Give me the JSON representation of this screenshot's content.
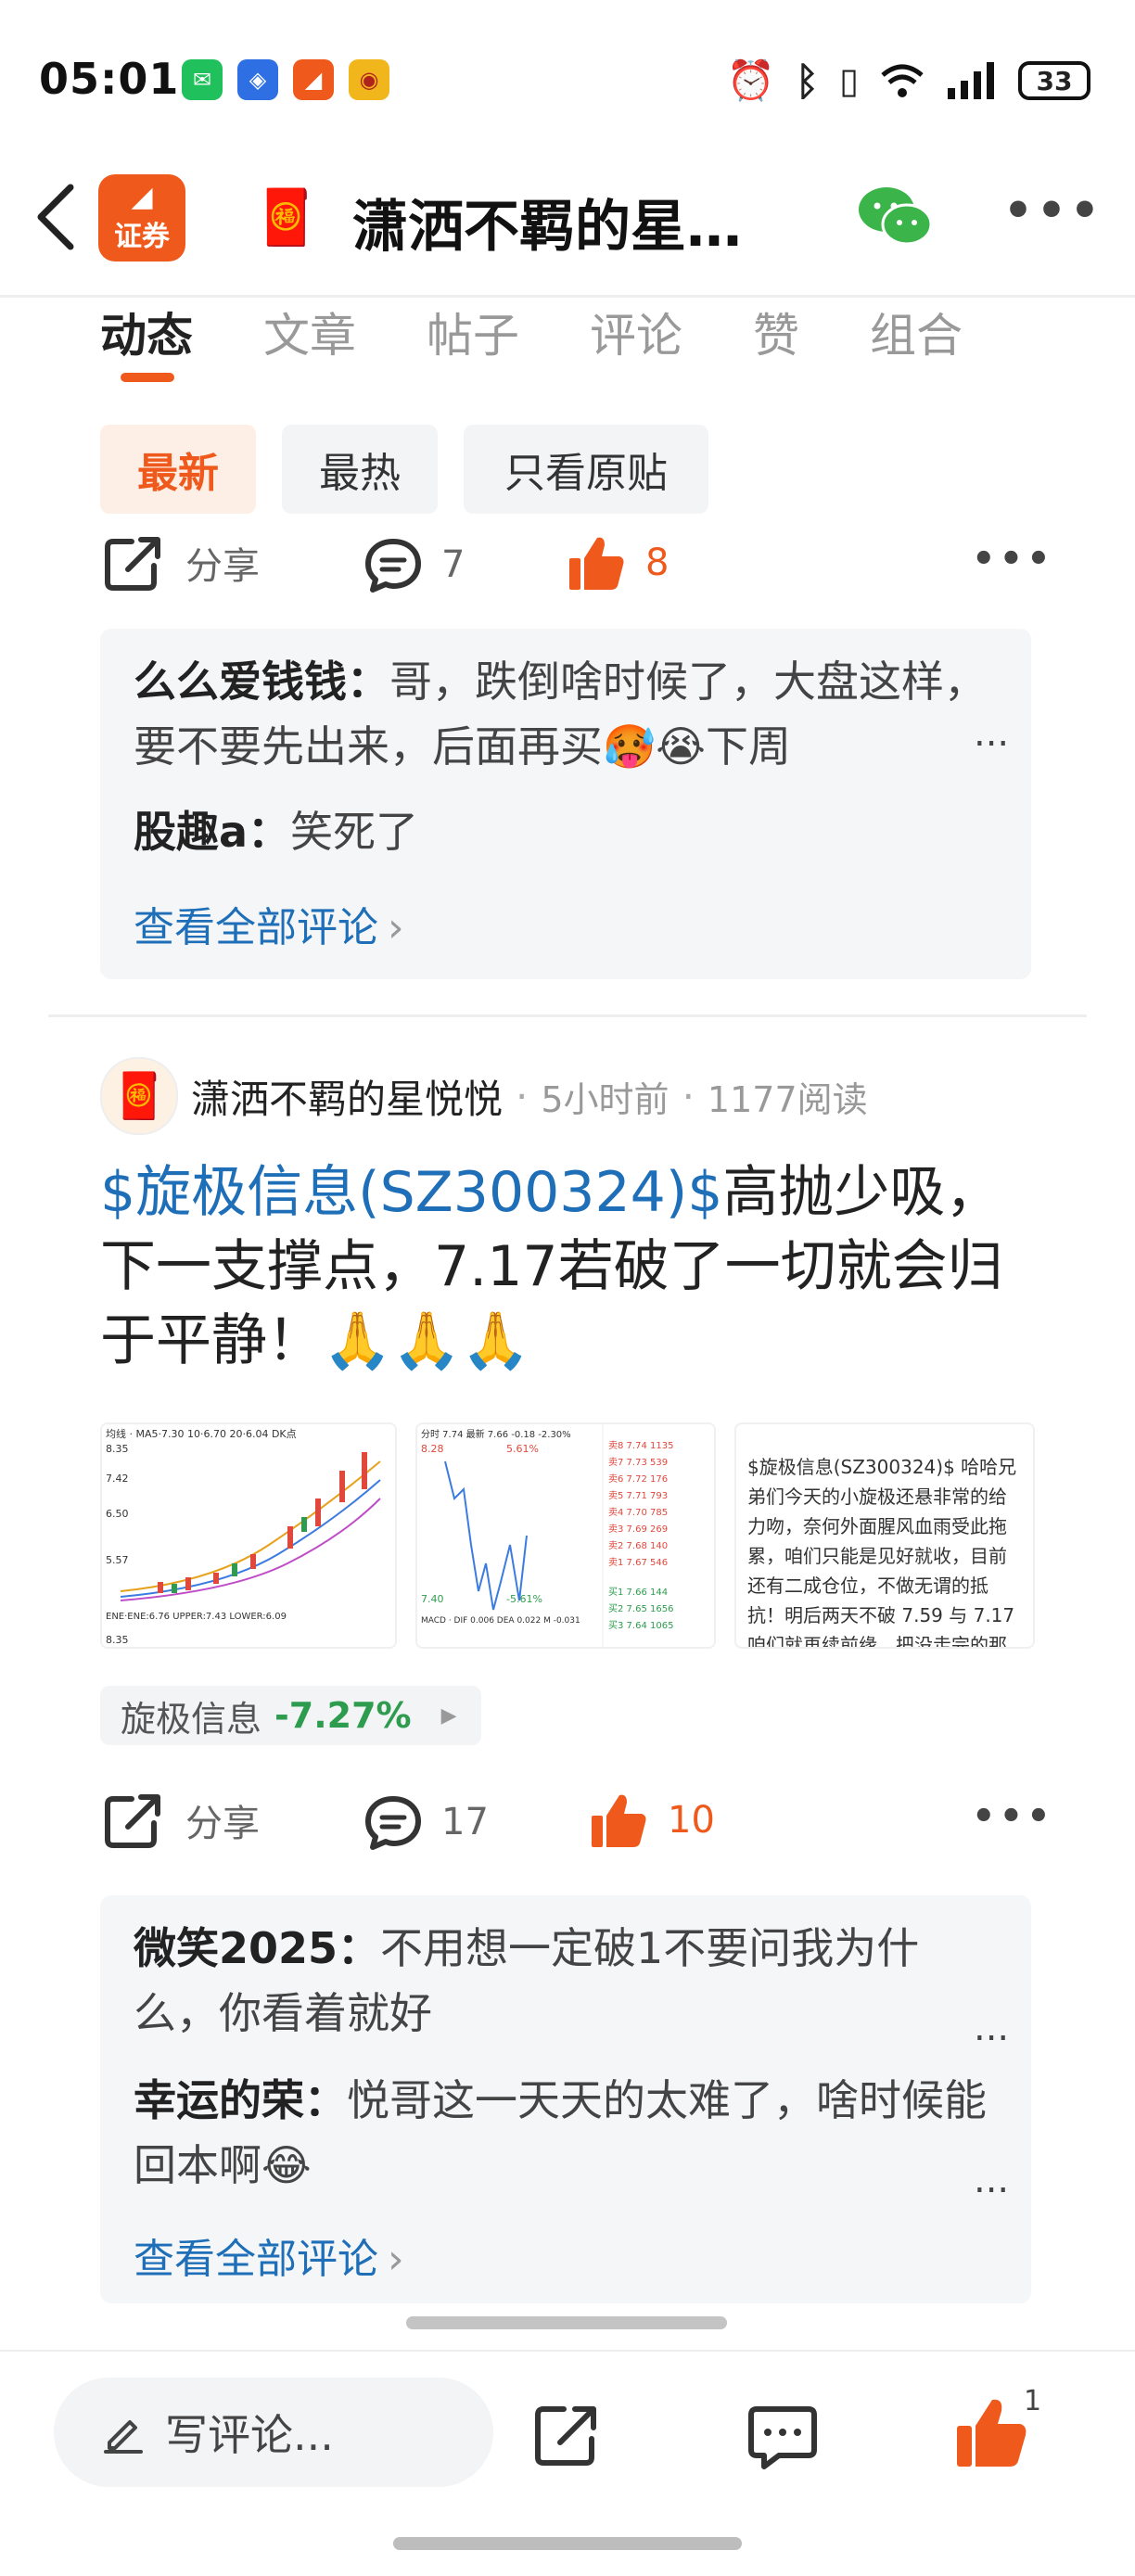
{
  "status": {
    "time": "05:01",
    "battery": "33"
  },
  "header": {
    "brand_label": "证券",
    "title": "潇洒不羁的星…"
  },
  "tabs": [
    "动态",
    "文章",
    "帖子",
    "评论",
    "赞",
    "组合"
  ],
  "filters": [
    "最新",
    "最热",
    "只看原贴"
  ],
  "post1": {
    "share": "分享",
    "comments": "7",
    "likes": "8",
    "comment1_user": "么么爱钱钱",
    "comment1_text": "哥，跌倒啥时候了，大盘这样，要不要先出来，后面再买🥵😭下周",
    "comment2_user": "股趣a",
    "comment2_text": "笑死了",
    "view_all": "查看全部评论"
  },
  "post2": {
    "author": "潇洒不羁的星悦悦",
    "time": "5小时前",
    "reads": "1177阅读",
    "title_stock": "$旋极信息(SZ300324)$",
    "title_text": "高抛少吸，下一支撑点，7.17若破了一切就会归于平静！🙏🙏🙏",
    "thumb3_text": "$旋极信息(SZ300324)$ 哈哈兄弟们今天的小旋极还悬非常的给力吻，奈何外面腥风血雨受此拖累，咱们只能是见好就收，目前还有二成仓位，不做无谓的抵抗！明后两天不破 7.59 与 7.17 咱们就再续前缘，把没走完的那段波澜壮阔的路",
    "stock_name": "旋极信息",
    "stock_change": "-7.27%",
    "share": "分享",
    "comments": "17",
    "likes": "10",
    "comment1_user": "微笑2025",
    "comment1_text": "不用想一定破1不要问我为什么，你看着就好",
    "comment2_user": "幸运的荣",
    "comment2_text": "悦哥这一天天的太难了，啥时候能回本啊😂",
    "view_all": "查看全部评论"
  },
  "bottom": {
    "input_placeholder": "写评论...",
    "like_count": "1"
  },
  "colors": {
    "accent": "#ef5a1c",
    "link": "#1e6fb8",
    "down": "#2e9c4e"
  }
}
